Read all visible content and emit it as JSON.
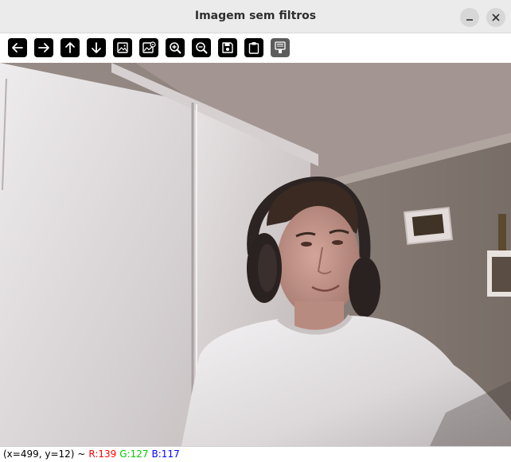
{
  "window": {
    "title": "Imagem sem filtros",
    "minimize_icon": "minimize-icon",
    "close_icon": "close-icon"
  },
  "toolbar": {
    "buttons": [
      {
        "icon": "arrow-left-icon",
        "enabled": true
      },
      {
        "icon": "arrow-right-icon",
        "enabled": true
      },
      {
        "icon": "arrow-up-icon",
        "enabled": true
      },
      {
        "icon": "arrow-down-icon",
        "enabled": true
      },
      {
        "icon": "image-icon",
        "enabled": true
      },
      {
        "icon": "image-settings-icon",
        "enabled": true
      },
      {
        "icon": "zoom-in-icon",
        "enabled": true
      },
      {
        "icon": "zoom-out-icon",
        "enabled": true
      },
      {
        "icon": "save-icon",
        "enabled": true
      },
      {
        "icon": "clipboard-icon",
        "enabled": true
      },
      {
        "icon": "properties-icon",
        "enabled": false
      }
    ]
  },
  "status": {
    "coords": "(x=499, y=12) ~",
    "r": "R:139",
    "g": "G:127",
    "b": "B:117",
    "r_color": "#ff0000",
    "g_color": "#00cc00",
    "b_color": "#0000ff"
  },
  "colors": {
    "titlebar_bg": "#ebebeb",
    "toolbar_button": "#000000",
    "toolbar_button_disabled": "#5c5c5c"
  }
}
